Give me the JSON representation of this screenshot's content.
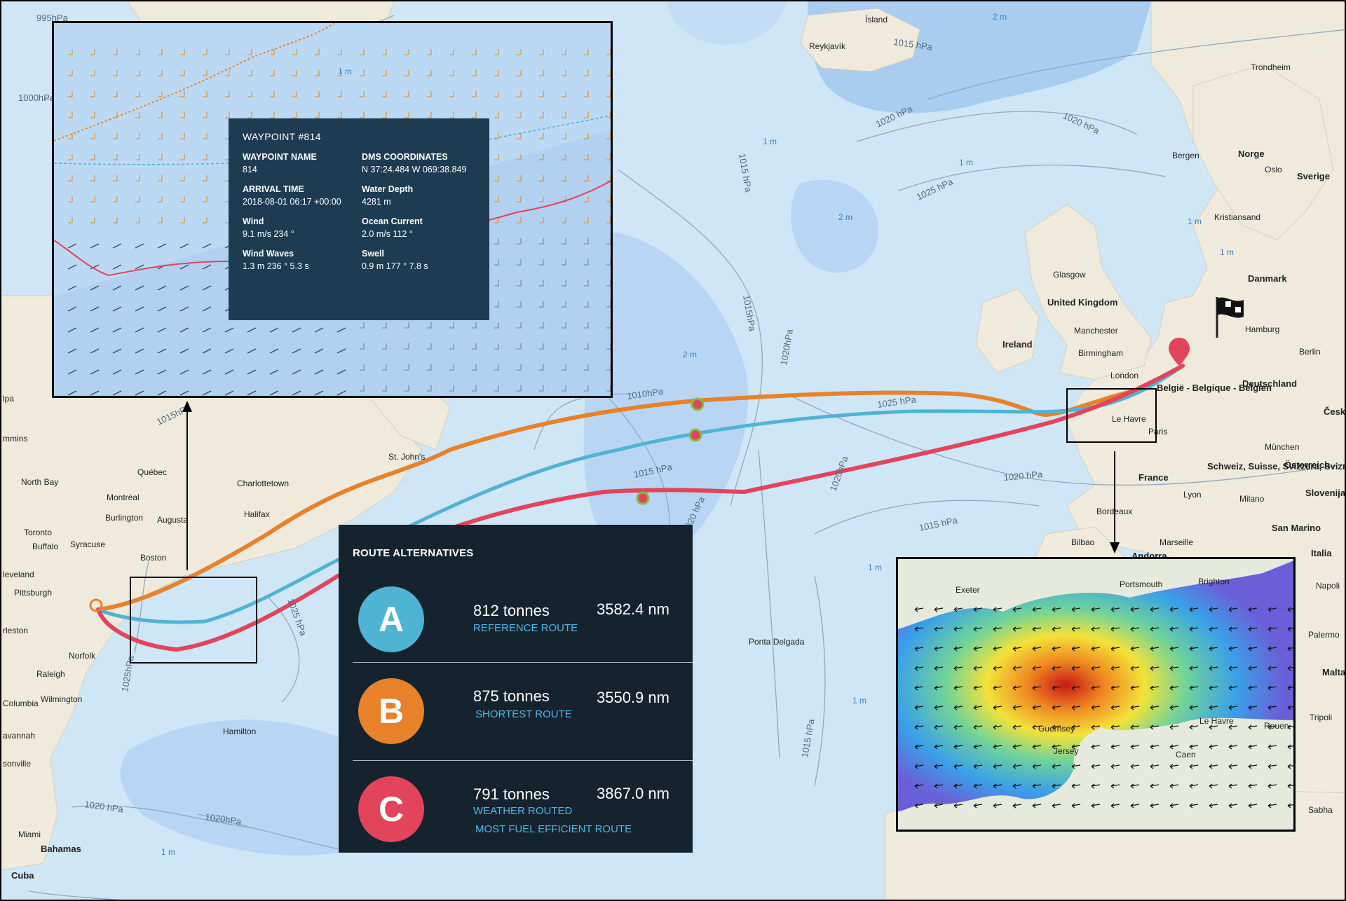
{
  "map": {
    "isobars": [
      "995hPa",
      "1000hPa",
      "1010hPa",
      "1015 hPa",
      "1015 hPa",
      "1015hPa",
      "1015hPa",
      "1020 hPa",
      "1020 hPa",
      "1020hPa",
      "1020hPa",
      "1020 hPa",
      "1025 hPa",
      "1025 hPa",
      "1025 hPa",
      "1025hPa",
      "1015 hPa",
      "1015 hPa",
      "1020 hPa",
      "1020 hPa",
      "1020hPa",
      "1015 hPa"
    ],
    "wave_labels": [
      "2 m",
      "1 m",
      "1 m",
      "2 m",
      "2 m",
      "1 m",
      "1 m",
      "1 m",
      "1 m",
      "1 m"
    ],
    "places": [
      "Ísland",
      "Reykjavík",
      "Trondheim",
      "Bergen",
      "Norge",
      "Oslo",
      "Sverige",
      "Kristiansand",
      "Danmark",
      "Glasgow",
      "United Kingdom",
      "Ireland",
      "Manchester",
      "Birmingham",
      "London",
      "Hamburg",
      "Berlin",
      "Deutschland",
      "België - Belgique - Belgien",
      "Le Havre",
      "Paris",
      "France",
      "München",
      "Schweiz, Suisse, Svizzera, Svizra",
      "Österreich",
      "Slovenija",
      "Lyon",
      "Milano",
      "Bordeaux",
      "San Marino",
      "Bilbao",
      "Marseille",
      "Andorra",
      "Italia",
      "Napoli",
      "Palermo",
      "Malta",
      "Tripoli",
      "Sabha",
      "Česk",
      "Québec",
      "North Bay",
      "Montréal",
      "Charlottetown",
      "St. John's",
      "Halifax",
      "Toronto",
      "Burlington",
      "Augusta",
      "Buffalo",
      "Syracuse",
      "Boston",
      "Pittsburgh",
      "Norfolk",
      "Raleigh",
      "Wilmington",
      "Columbia",
      "Hamilton",
      "Ponta Delgada",
      "Miami",
      "Bahamas",
      "Cuba",
      "mmins",
      "leveland",
      "rleston",
      "avannah",
      "sonville",
      "lpa"
    ]
  },
  "waypoint": {
    "header": "WAYPOINT #814",
    "fields": [
      {
        "label": "WAYPOINT NAME",
        "value": "814"
      },
      {
        "label": "DMS COORDINATES",
        "value": "N 37:24.484  W 069:38.849"
      },
      {
        "label": "ARRIVAL TIME",
        "value": "2018-08-01 06:17 +00:00"
      },
      {
        "label": "Water Depth",
        "value": "4281 m"
      },
      {
        "label": "Wind",
        "value": "9.1 m/s  234 °"
      },
      {
        "label": "Ocean Current",
        "value": "2.0 m/s  112 °"
      },
      {
        "label": "Wind Waves",
        "value": "1.3 m  236 °  5.3 s"
      },
      {
        "label": "Swell",
        "value": "0.9 m  177 °  7.8 s"
      }
    ],
    "inset_labels": [
      "1 m"
    ]
  },
  "route_panel": {
    "title": "ROUTE ALTERNATIVES",
    "routes": [
      {
        "letter": "A",
        "tonnes": "812 tonnes",
        "distance": "3582.4 nm",
        "desc": [
          "REFERENCE ROUTE"
        ],
        "color": "#4fb3d4"
      },
      {
        "letter": "B",
        "tonnes": "875 tonnes",
        "distance": "3550.9 nm",
        "desc": [
          "SHORTEST ROUTE"
        ],
        "color": "#e8822a"
      },
      {
        "letter": "C",
        "tonnes": "791 tonnes",
        "distance": "3867.0 nm",
        "desc": [
          "WEATHER ROUTED",
          "MOST FUEL EFFICIENT ROUTE"
        ],
        "color": "#e2445c"
      }
    ]
  },
  "channel_inset": {
    "places": [
      "Exeter",
      "Portsmouth",
      "Brighton",
      "Guernsey",
      "Jersey",
      "Caen",
      "Le Havre",
      "Rouen"
    ]
  },
  "colors": {
    "route_a": "#4fb3d4",
    "route_b": "#e8822a",
    "route_c": "#e2445c",
    "sea": "#cfe6f7",
    "land": "#efeadc"
  }
}
